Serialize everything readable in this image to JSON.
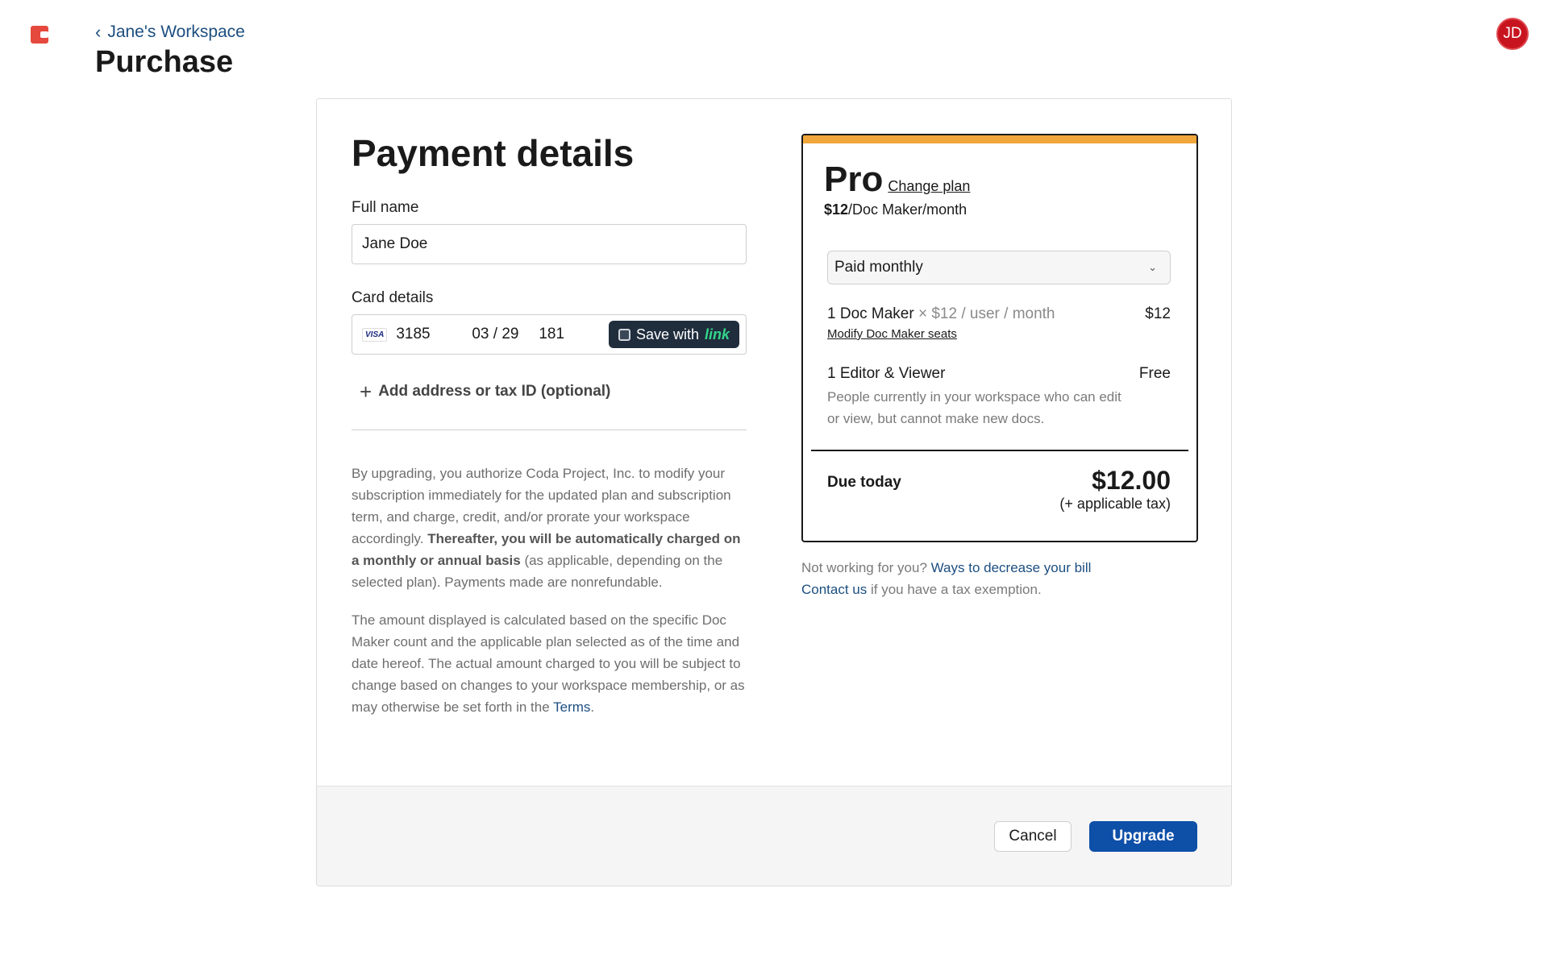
{
  "app": {
    "logo_icon": "coda-logo-icon",
    "avatar_initials": "JD",
    "brand_color": "#e5483c",
    "primary_color": "#0e4fa8"
  },
  "header": {
    "back_label": "Jane's Workspace",
    "title": "Purchase"
  },
  "payment": {
    "heading": "Payment details",
    "full_name_label": "Full name",
    "full_name_value": "Jane Doe",
    "card_label": "Card details",
    "card_brand": "VISA",
    "card_number": "3185",
    "card_expiry": "03 / 29",
    "card_cvc": "181",
    "save_with": "Save with",
    "link_brand": "link",
    "add_address_label": "Add address or tax ID (optional)",
    "legal1_a": "By upgrading, you authorize Coda Project, Inc. to modify your subscription immediately for the updated plan and subscription term, and charge, credit, and/or prorate your workspace accordingly. ",
    "legal1_b": "Thereafter, you will be automatically charged on a monthly or annual basis",
    "legal1_c": " (as applicable, depending on the selected plan). Payments made are nonrefundable.",
    "legal2": "The amount displayed is calculated based on the specific Doc Maker count and the applicable plan selected as of the time and date hereof. The actual amount charged to you will be subject to change based on changes to your workspace membership, or as may otherwise be set forth in the ",
    "terms_link": "Terms",
    "legal2_end": "."
  },
  "plan": {
    "accent_color": "#f0a63a",
    "name": "Pro",
    "change_plan": "Change plan",
    "price_bold": "$12",
    "price_rest": "/Doc Maker/month",
    "billing_selected": "Paid monthly",
    "line1_qty": "1 Doc Maker",
    "line1_detail": " × $12 / user / month",
    "line1_amount": "$12",
    "modify_seats": "Modify Doc Maker seats",
    "line2_label": "1 Editor & Viewer",
    "line2_amount": "Free",
    "line2_desc": "People currently in your workspace who can edit or view, but cannot make new docs.",
    "due_label": "Due today",
    "due_amount": "$12.00",
    "due_tax": "(+ applicable tax)"
  },
  "help": {
    "q": "Not working for you? ",
    "ways_link": "Ways to decrease your bill",
    "contact_link": "Contact us",
    "contact_rest": " if you have a tax exemption."
  },
  "footer": {
    "cancel_label": "Cancel",
    "upgrade_label": "Upgrade"
  }
}
